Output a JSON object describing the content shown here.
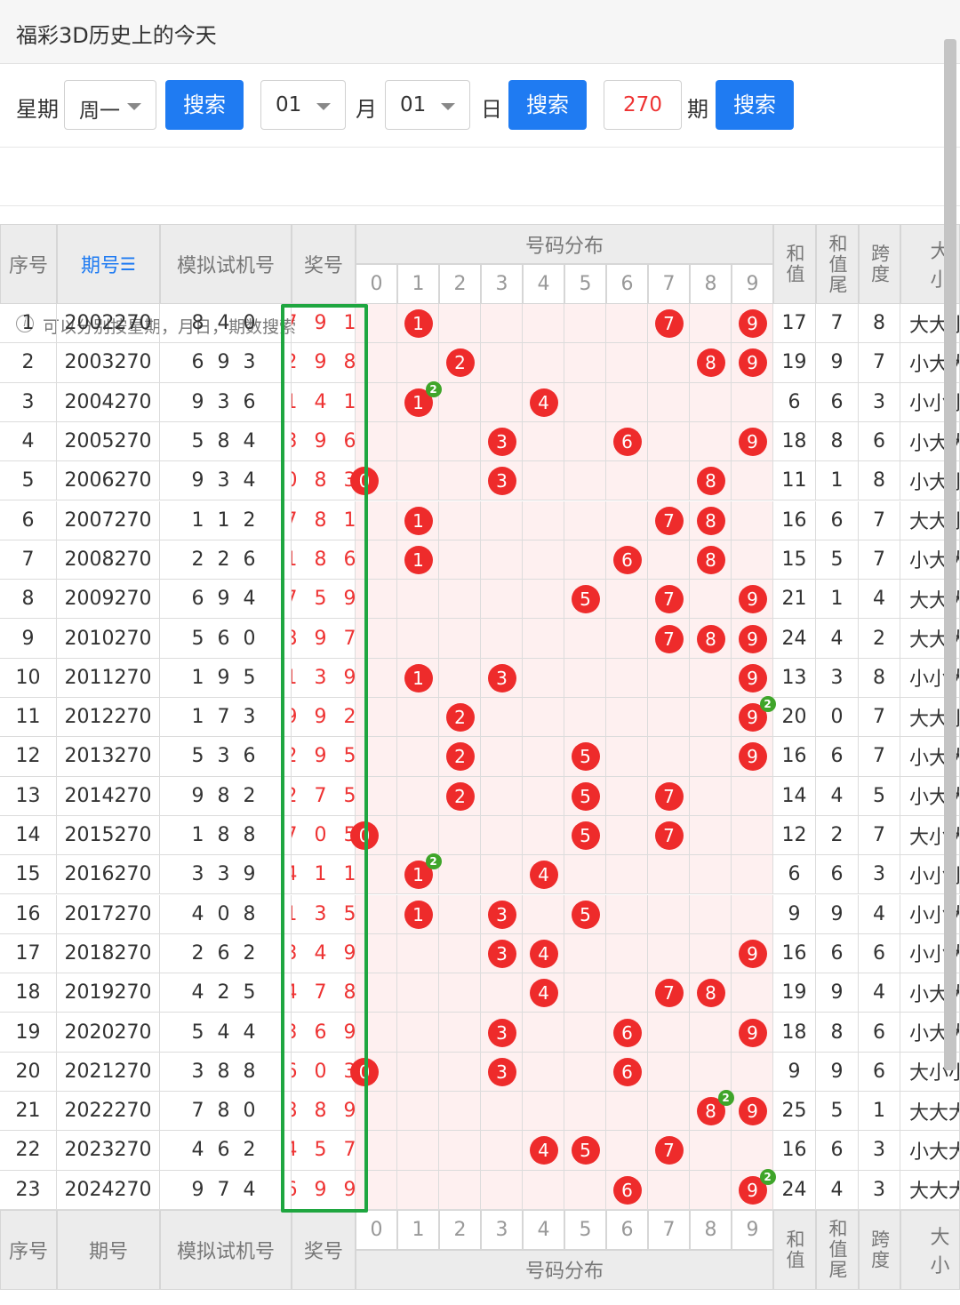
{
  "page_title": "福彩3D历史上的今天",
  "search": {
    "weekday_label": "星期",
    "weekday_value": "周一",
    "search_btn": "搜索",
    "month_value": "01",
    "month_label": "月",
    "day_value": "01",
    "day_label": "日",
    "period_value": "270",
    "period_label": "期"
  },
  "hint": "可以分别按星期，月日，期数搜索",
  "table": {
    "headers": {
      "seq": "序号",
      "issue": "期号",
      "sim": "模拟试机号",
      "prize": "奖号",
      "dist": "号码分布",
      "sum": "和值",
      "sum_tail": "和值尾",
      "span": "跨度",
      "size": "大小"
    },
    "digits": [
      "0",
      "1",
      "2",
      "3",
      "4",
      "5",
      "6",
      "7",
      "8",
      "9"
    ],
    "rows": [
      {
        "seq": "1",
        "issue": "2002270",
        "sim": "8 4 0",
        "prize": "7 9 1",
        "sum": "17",
        "tail": "7",
        "span": "8",
        "size": "大大小"
      },
      {
        "seq": "2",
        "issue": "2003270",
        "sim": "6 9 3",
        "prize": "2 9 8",
        "sum": "19",
        "tail": "9",
        "span": "7",
        "size": "小大大"
      },
      {
        "seq": "3",
        "issue": "2004270",
        "sim": "9 3 6",
        "prize": "1 4 1",
        "sum": "6",
        "tail": "6",
        "span": "3",
        "size": "小小小"
      },
      {
        "seq": "4",
        "issue": "2005270",
        "sim": "5 8 4",
        "prize": "3 9 6",
        "sum": "18",
        "tail": "8",
        "span": "6",
        "size": "小大大"
      },
      {
        "seq": "5",
        "issue": "2006270",
        "sim": "9 3 4",
        "prize": "0 8 3",
        "sum": "11",
        "tail": "1",
        "span": "8",
        "size": "小大小"
      },
      {
        "seq": "6",
        "issue": "2007270",
        "sim": "1 1 2",
        "prize": "7 8 1",
        "sum": "16",
        "tail": "6",
        "span": "7",
        "size": "大大小"
      },
      {
        "seq": "7",
        "issue": "2008270",
        "sim": "2 2 6",
        "prize": "1 8 6",
        "sum": "15",
        "tail": "5",
        "span": "7",
        "size": "小大大"
      },
      {
        "seq": "8",
        "issue": "2009270",
        "sim": "6 9 4",
        "prize": "7 5 9",
        "sum": "21",
        "tail": "1",
        "span": "4",
        "size": "大大大"
      },
      {
        "seq": "9",
        "issue": "2010270",
        "sim": "5 6 0",
        "prize": "8 9 7",
        "sum": "24",
        "tail": "4",
        "span": "2",
        "size": "大大大"
      },
      {
        "seq": "10",
        "issue": "2011270",
        "sim": "1 9 5",
        "prize": "1 3 9",
        "sum": "13",
        "tail": "3",
        "span": "8",
        "size": "小小大"
      },
      {
        "seq": "11",
        "issue": "2012270",
        "sim": "1 7 3",
        "prize": "9 9 2",
        "sum": "20",
        "tail": "0",
        "span": "7",
        "size": "大大小"
      },
      {
        "seq": "12",
        "issue": "2013270",
        "sim": "5 3 6",
        "prize": "2 9 5",
        "sum": "16",
        "tail": "6",
        "span": "7",
        "size": "小大大"
      },
      {
        "seq": "13",
        "issue": "2014270",
        "sim": "9 8 2",
        "prize": "2 7 5",
        "sum": "14",
        "tail": "4",
        "span": "5",
        "size": "小大大"
      },
      {
        "seq": "14",
        "issue": "2015270",
        "sim": "1 8 8",
        "prize": "7 0 5",
        "sum": "12",
        "tail": "2",
        "span": "7",
        "size": "大小大"
      },
      {
        "seq": "15",
        "issue": "2016270",
        "sim": "3 3 9",
        "prize": "4 1 1",
        "sum": "6",
        "tail": "6",
        "span": "3",
        "size": "小小小"
      },
      {
        "seq": "16",
        "issue": "2017270",
        "sim": "4 0 8",
        "prize": "1 3 5",
        "sum": "9",
        "tail": "9",
        "span": "4",
        "size": "小小大"
      },
      {
        "seq": "17",
        "issue": "2018270",
        "sim": "2 6 2",
        "prize": "3 4 9",
        "sum": "16",
        "tail": "6",
        "span": "6",
        "size": "小小大"
      },
      {
        "seq": "18",
        "issue": "2019270",
        "sim": "4 2 5",
        "prize": "4 7 8",
        "sum": "19",
        "tail": "9",
        "span": "4",
        "size": "小大大"
      },
      {
        "seq": "19",
        "issue": "2020270",
        "sim": "5 4 4",
        "prize": "3 6 9",
        "sum": "18",
        "tail": "8",
        "span": "6",
        "size": "小大大"
      },
      {
        "seq": "20",
        "issue": "2021270",
        "sim": "3 8 8",
        "prize": "6 0 3",
        "sum": "9",
        "tail": "9",
        "span": "6",
        "size": "大小小"
      },
      {
        "seq": "21",
        "issue": "2022270",
        "sim": "7 8 0",
        "prize": "8 8 9",
        "sum": "25",
        "tail": "5",
        "span": "1",
        "size": "大大大"
      },
      {
        "seq": "22",
        "issue": "2023270",
        "sim": "4 6 2",
        "prize": "4 5 7",
        "sum": "16",
        "tail": "6",
        "span": "3",
        "size": "小大大"
      },
      {
        "seq": "23",
        "issue": "2024270",
        "sim": "9 7 4",
        "prize": "6 9 9",
        "sum": "24",
        "tail": "4",
        "span": "3",
        "size": "大大大"
      }
    ]
  },
  "colors": {
    "ball": "#ee2b2b",
    "badge": "#3fa52a",
    "button": "#1f7bf2",
    "highlight_box": "#1fa640",
    "accent_header": "#1f7bf2"
  },
  "icons": {
    "sort": "sort-icon",
    "info": "info-icon"
  }
}
